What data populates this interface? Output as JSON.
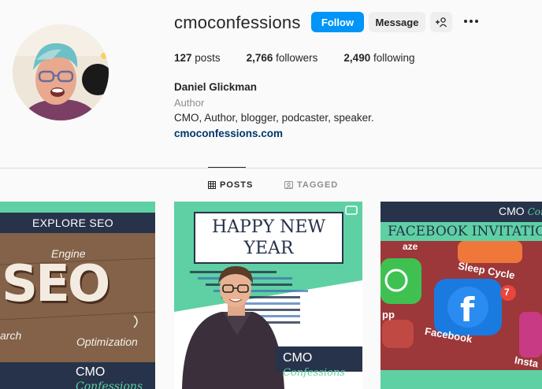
{
  "profile": {
    "username": "cmoconfessions",
    "follow_label": "Follow",
    "message_label": "Message",
    "adduser_label": "+♙",
    "more_label": "•••",
    "stats": {
      "posts_count": "127",
      "posts_label": "posts",
      "followers_count": "2,766",
      "followers_label": "followers",
      "following_count": "2,490",
      "following_label": "following"
    },
    "full_name": "Daniel Glickman",
    "category": "Author",
    "bio": "CMO, Author, blogger, podcaster, speaker.",
    "website": "cmoconfessions.com"
  },
  "tabs": {
    "posts": "POSTS",
    "tagged": "TAGGED"
  },
  "posts": [
    {
      "banner": "EXPLORE SEO",
      "big_text": "SEO",
      "words": [
        "Engine",
        "arch",
        "Optimization"
      ],
      "brand_a": "CMO",
      "brand_b": "Confessions"
    },
    {
      "headline_1": "HAPPY NEW",
      "headline_2": "YEAR",
      "brand_a": "CMO",
      "brand_b": "Confessions"
    },
    {
      "brand_a": "CMO",
      "brand_b": "Confessions",
      "banner": "FACEBOOK INVITATIO",
      "app_labels": [
        "Sleep Cycle",
        "Facebook",
        "Insta",
        "pp",
        "aze"
      ],
      "badge": "7"
    }
  ],
  "colors": {
    "accent": "#0095f6",
    "teal": "#5ed0a4",
    "navy": "#27334a",
    "link": "#00376b"
  }
}
